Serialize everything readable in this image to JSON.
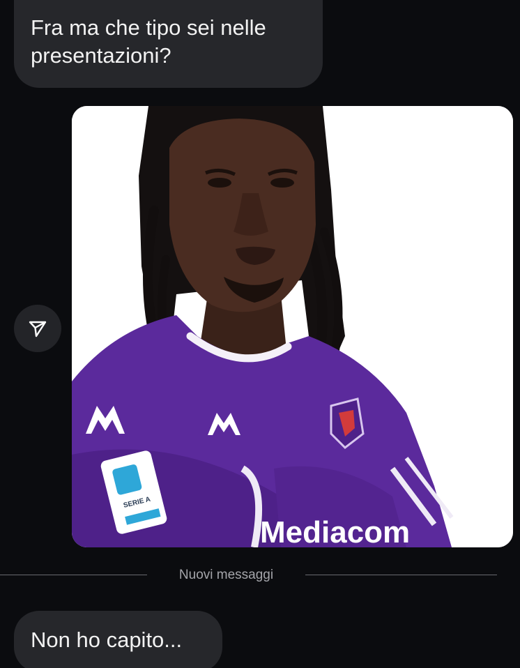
{
  "messages": [
    {
      "text": "Fra ma che tipo sei nelle presentazioni?"
    },
    {
      "text": "Non ho capito..."
    }
  ],
  "image_message": {
    "jersey_sponsor_text": "Mediacom",
    "patch_text": "SERIE A",
    "jersey_color": "#5b2a9c"
  },
  "share_icon": "paper-plane-icon",
  "divider": {
    "label": "Nuovi messaggi"
  },
  "colors": {
    "background": "#0b0c0f",
    "bubble": "#26272b",
    "text": "#f2f2f2",
    "divider_text": "#a4a5aa"
  }
}
